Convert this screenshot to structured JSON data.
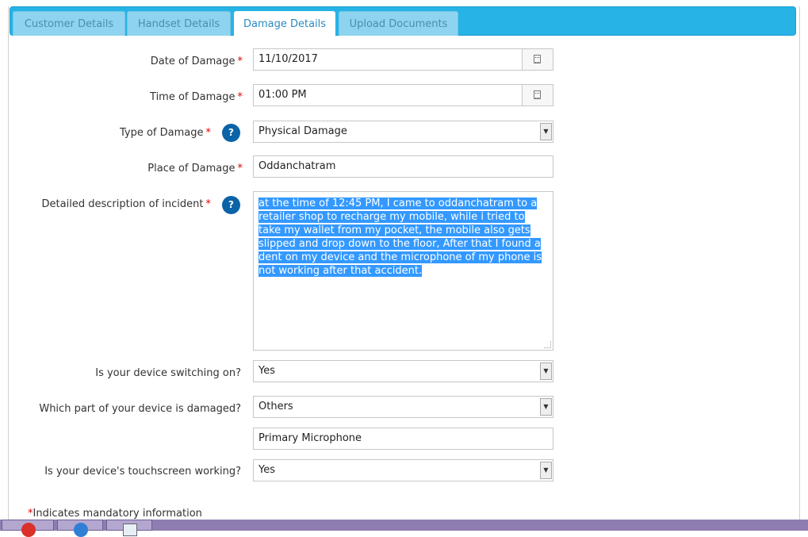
{
  "tabs": [
    {
      "label": "Customer Details"
    },
    {
      "label": "Handset Details"
    },
    {
      "label": "Damage Details"
    },
    {
      "label": "Upload Documents"
    }
  ],
  "form": {
    "date_label": "Date of Damage",
    "date_value": "11/10/2017",
    "time_label": "Time of Damage",
    "time_value": "01:00 PM",
    "type_label": "Type of Damage",
    "type_value": "Physical Damage",
    "place_label": "Place of Damage",
    "place_value": "Oddanchatram",
    "desc_label": "Detailed description of incident",
    "desc_value": "at the time of 12:45 PM, I came to oddanchatram to a retailer shop to recharge my mobile, while i tried to take my wallet from my pocket, the mobile also gets slipped and drop down to the floor, After that I found a dent on my device and the microphone of my phone is not working after that accident.",
    "switching_label": "Is your device switching on?",
    "switching_value": "Yes",
    "part_label": "Which part of your device is damaged?",
    "part_value": "Others",
    "part_other_value": "Primary Microphone",
    "touch_label": "Is your device's touchscreen working?",
    "touch_value": "Yes",
    "required_mark": "*",
    "help_mark": "?"
  },
  "footer": {
    "mandatory_mark": "*",
    "mandatory_note": "Indicates mandatory information"
  },
  "colors": {
    "tabbar": "#27b3e6",
    "help": "#0b63a8",
    "selection": "#3399ff",
    "required": "#dd0000"
  }
}
